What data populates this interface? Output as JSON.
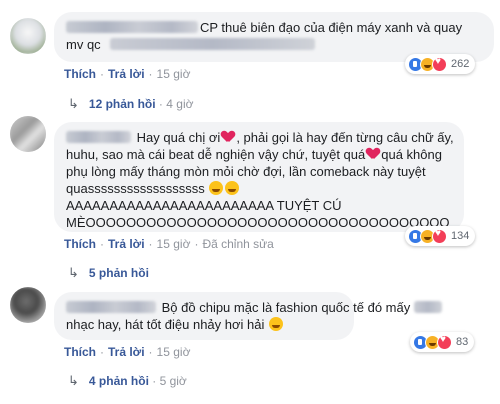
{
  "comments": [
    {
      "author_hidden": true,
      "text": "CP thuê biên đạo của điện máy xanh và quay",
      "text_line2": "mv qc",
      "actions": {
        "like": "Thích",
        "reply": "Trả lời",
        "time": "15 giờ"
      },
      "reactions": {
        "icons": [
          "like-icon",
          "haha-icon",
          "love-icon"
        ],
        "count": "262"
      },
      "replies": {
        "label": "12 phản hồi",
        "time": "4 giờ"
      }
    },
    {
      "author_hidden": true,
      "lines": [
        "Hay quá chị ơi",
        ", phải gọi là hay đến từng câu chữ ấy,",
        "huhu, sao mà cái beat dễ nghiện vậy chứ, tuyệt quá",
        "quá không",
        "phụ lòng mấy tháng mòn mỏi chờ đợi, lần comeback này tuyệt",
        "quassssssssssssssssss",
        "AAAAAAAAAAAAAAAAAAAAAAAA TUYỆT CÚ",
        "MÈOOOOOOOOOOOOOOOOOOOOOOOOOOOOOOOOOOOO"
      ],
      "actions": {
        "like": "Thích",
        "reply": "Trả lời",
        "time": "15 giờ",
        "edited": "Đã chỉnh sửa"
      },
      "reactions": {
        "icons": [
          "like-icon",
          "haha-icon",
          "love-icon"
        ],
        "count": "134"
      },
      "replies": {
        "label": "5 phản hồi"
      }
    },
    {
      "author_hidden": true,
      "text": "Bộ đồ chipu mặc là fashion quốc tế đó mấy",
      "text_line2": "nhạc hay, hát tốt điệu nhảy hơi hải",
      "actions": {
        "like": "Thích",
        "reply": "Trả lời",
        "time": "15 giờ"
      },
      "reactions": {
        "icons": [
          "like-icon",
          "haha-icon",
          "love-icon"
        ],
        "count": "83"
      },
      "replies": {
        "label": "4 phản hồi",
        "time": "5 giờ"
      }
    }
  ],
  "colors": {
    "link": "#385898",
    "bubble": "#f2f3f5",
    "meta": "#90949c"
  }
}
